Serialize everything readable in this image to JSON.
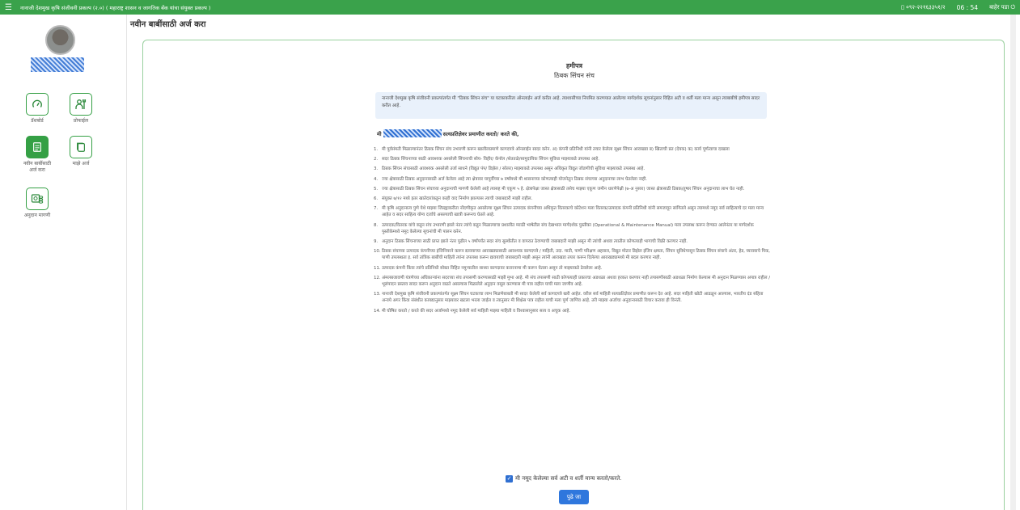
{
  "topbar": {
    "title": "नानाजी देशमुख कृषि संजीवनी प्रकल्प (२.०) ( महाराष्ट्र शासन व जागतिक बँक यांचा संयुक्त प्रकल्प )",
    "phone": "०९२-२२१६३३५१/२",
    "time": "06 : 54",
    "logout_label": "बाहेर पडा"
  },
  "sidebar": {
    "items": [
      {
        "label": "डॅशबोर्ड",
        "icon": "gauge-icon"
      },
      {
        "label": "प्रोफाईल",
        "icon": "farmer-profile-icon"
      },
      {
        "label": "नवीन बाबींसाठी अर्ज करा",
        "icon": "application-form-icon"
      },
      {
        "label": "माझे अर्ज",
        "icon": "documents-icon"
      },
      {
        "label": "अनुदान मागणी",
        "icon": "subsidy-money-icon"
      }
    ]
  },
  "page": {
    "title": "नवीन बाबींसाठी अर्ज करा"
  },
  "document": {
    "heading": "हमीपत्र",
    "subheading": "ठिबक सिंचन संच",
    "intro": "नानाजी देशमुख कृषि संजीवनी प्रकल्पांतर्गत मी \"ठिबक सिंचन संच\" या घटकाकरिता ऑनलाईन अर्ज करीत आहे. त्याशासीच्या नियमित करणयात आलेल्या मार्गदर्शक सूचनांनुसार विहित अटी व शर्ती मला मान्य असून त्याबाबीचे हमीपत्र सादर करीत आहे.",
    "declaration_prefix": "मी",
    "declaration_suffix": "सत्यप्रतिज्ञेवर प्रमाणीत करतो/ करते की,",
    "items": [
      {
        "num": "1.",
        "text": "मी पूर्वसंमती मिळाल्यानंतर ठिबक सिंचन संच उभारणी करून खालीलप्रमाणे कागदपत्रे ऑनलाईन सादर करेन. अ) कंपनी प्रतिनिधी यांनी तयार केलेला सूक्ष्म सिंचन आराखडा ब) खिताची प्रत (देयक) क) कार्य पूर्णत्वाचा दाखला"
      },
      {
        "num": "2.",
        "text": "सदर ठिबक सिंचनाच्या साठी आवश्यक असलेली सिंचनाची सोय- विहीर/ कॅनॉल /शेततळे/सामुदायिक सिंचन सुविधा माझ्याकडे उपलब्ध आहे."
      },
      {
        "num": "3.",
        "text": "ठिबक सिंचन संचासाठी आवश्यक असलेली उर्जा साधने (विद्युत पंप/ डिझेल / सोलर) माझ्याकडे उपलब्ध असून अधिकृत विद्युत जोडणीची सुविधा माझ्याकडे उपलब्ध आहे."
      },
      {
        "num": "4.",
        "text": "ज्या क्षेत्रासाठी ठिबक अनुदानासाठी अर्ज केलेला आहे त्या क्षेत्रावर यापूर्वीच्या ७ वर्षांमध्ये मी शासनाच्या कोणत्याही योजनेतून ठिबक संचाच्या अनुदानाचा लाभ घेतलेला नाही."
      },
      {
        "num": "5.",
        "text": "ज्या क्षेत्रासाठी ठिबक सिंचन संचाच्या अनुदानाची मागणी केलेली आहे त्यासह मी एकूण ५ हे. क्षेत्रापेक्षा जास्त क्षेत्रासाठी तसेच माझ्या एकूण जमीन धारणेपेक्षी (७-अ नुसार) जास्त क्षेत्रासाठी ठिबक/तुषार सिंचन अनुदानाचा लाभ घेत नाही."
      },
      {
        "num": "6.",
        "text": "संयुक्त ७/१२ मध्ये इतर खातेदारांकडून काही वाद निर्माण झाल्यास त्याची जबाबदारी माझी राहील."
      },
      {
        "num": "7.",
        "text": "मी कृषि अनुदानात्य पुणे येथे माझ्या जिल्ह्याकरीता नोंदणीकृत असलेल्या सूक्ष्म सिंचन उत्पादक कंपनीच्या अधिकृत वितरकाचे कोटेशन मला वितरक/उत्पादक कंपनी प्रतिनिधी यांनी समजावून सांगितले असून त्यामध्ये नमूद सर्व साहित्याचे दर मला मान्य आहेत व सदर साहित्य योग्य दर्जाचे असल्याची खात्री करूनच घेतले आहे."
      },
      {
        "num": "8.",
        "text": "उत्पादक/वितरक यांचे कडून संच उभारणी झाले नंतर त्यांचे कडून मिळाल्याचा प्रशालीत मराठी भाषेतील संच देखभाल मार्गदर्शक पुस्तीका (Operational & Maintenance Manual) मला उपलब्ध करून देण्यात आलेनंतर या मार्गदर्शक पुस्तीकेमध्ये नमूद केलेल्या सूचनांची मी पालन करेन."
      },
      {
        "num": "9.",
        "text": "अनुदान ठिबक सिंचनाच्या साठी प्राप्त झाले नंतर पुढील ५ वर्षांपर्यंत सदर संच सुस्थीतीत व वापरात ठेवण्याची जबाबदारी माझी असून मी त्यांची अथवा त्यातील कोणत्याही भागाची विक्री करणार नाही."
      },
      {
        "num": "10.",
        "text": "ठिबक संचाच्या उत्पादक कंपनीच्या इंजिनियरने करून द्यावयाच्या आराखड्यासाठी आवश्यक कागदपत्रे / माहिती, उदा. माती, पाणी परिक्षण अहवाल, विद्युत मोटार डिझेल इंजिन क्षमता, सिंचन सुविधेपासून ठिबक सिंचन संचाचे अंतर, हेड, घ्यावयाचे पिक, पाणी उपलब्धता इ. सर्व तांत्रिक बाबींची माहिती त्यांना उपलब्ध करून द्यावयाची जबाबदारी माझी असून त्यांनी आराखडा तयार करून दिलेल्या आराखड्यामध्ये मी बदल करणार नाही."
      },
      {
        "num": "11.",
        "text": "उत्पादक कंपनी किंवा त्यांचे प्रतिनिधी सोबत विहित नमुन्यातील साध्या कागदावर करारनामा मी करून घेतला असून तो माझ्याकडे ठेवलेला आहे."
      },
      {
        "num": "12.",
        "text": "अंमलबजावणी यंत्रणेच्या अधिकाऱ्यांना सदरच्या संच तपासणी करण्यासाठी माझी मुभा आहे. मी संच तपासणी साठी कोणत्याही प्रकारचा अडथळा अथवा हरकत करणार नाही तपासणीसाठी अडथळा निर्माण केल्यास मी अनुदान मिळण्यास अपात्र राहील / भूसंपादन प्रस्ताव सादर करून अनुदान वाढते असल्यास मिळालेले अनुदान वसूल करण्यास मी पात्र राहील याची मला जाणीव आहे."
      },
      {
        "num": "13.",
        "text": "नानाजी देशमुख कृषि संजीवनी प्रकल्पांतर्गत सूक्ष्म सिंचन घटकाचा लाभ मिळणेबाबती मी सादर केलेली सर्व कागदपत्रे खरी आहेत. वरील सर्व माहिती सत्यप्रतिज्ञेवर प्रमाणीत करून देत आहे. सदर माहिती खोटी आढळून आल्यास, भारतीय दंड संहिता अन्वये अगर किंवा संबंधीत कायद्यानुसार माझ्यावर खटला भरला जाईल व त्यानुसार मी शिक्षेस पात्र राहील याची मला पूर्ण जाणिव आहे. तरी माझ्या अर्जाचा अनुदानासाठी विचार करावा ही विनंती."
      },
      {
        "num": "14.",
        "text": "मी घोषित करतो / करते की सदर अर्जामध्ये नमूद केलेली सर्व माहिती माझ्या माहिती व विश्वासानुसार सत्य व अचूक आहे."
      }
    ],
    "agree_label": "मी नमूद केलेल्या सर्व अटी व शर्ती मान्य करतो/करते.",
    "next_label": "पुढे जा"
  }
}
